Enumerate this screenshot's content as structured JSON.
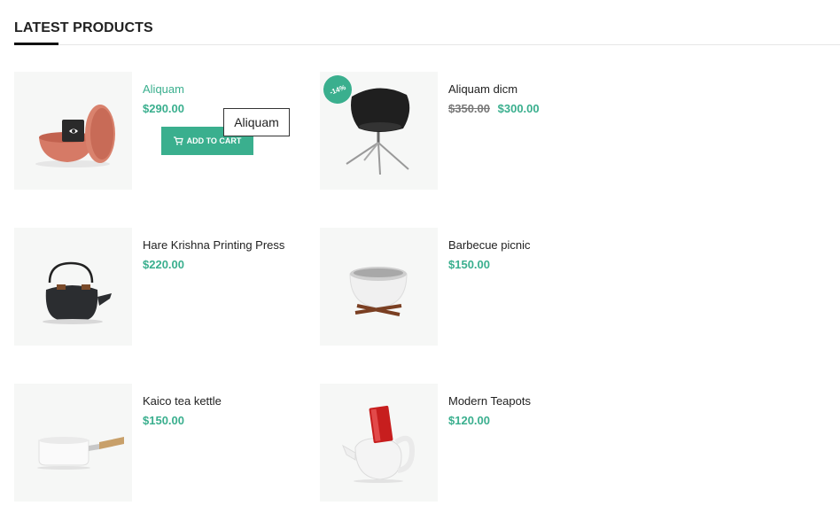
{
  "section": {
    "title": "LATEST PRODUCTS"
  },
  "tooltip": "Aliquam",
  "add_to_cart_label": "ADD TO CART",
  "products": [
    {
      "name": "Aliquam",
      "price": "$290.00",
      "image": "bowl",
      "hovered": true
    },
    {
      "name": "Aliquam dicm",
      "old_price": "$350.00",
      "price": "$300.00",
      "badge": "-14%",
      "image": "chair"
    },
    {
      "name": "Hare Krishna Printing Press",
      "price": "$220.00",
      "image": "kettle-black"
    },
    {
      "name": "Barbecue picnic",
      "price": "$150.00",
      "image": "grill"
    },
    {
      "name": "Kaico tea kettle",
      "price": "$150.00",
      "image": "saucepan"
    },
    {
      "name": "Modern Teapots",
      "price": "$120.00",
      "image": "teapot-red"
    }
  ],
  "colors": {
    "accent": "#3aaf8e",
    "thumb_bg": "#f6f7f6"
  }
}
